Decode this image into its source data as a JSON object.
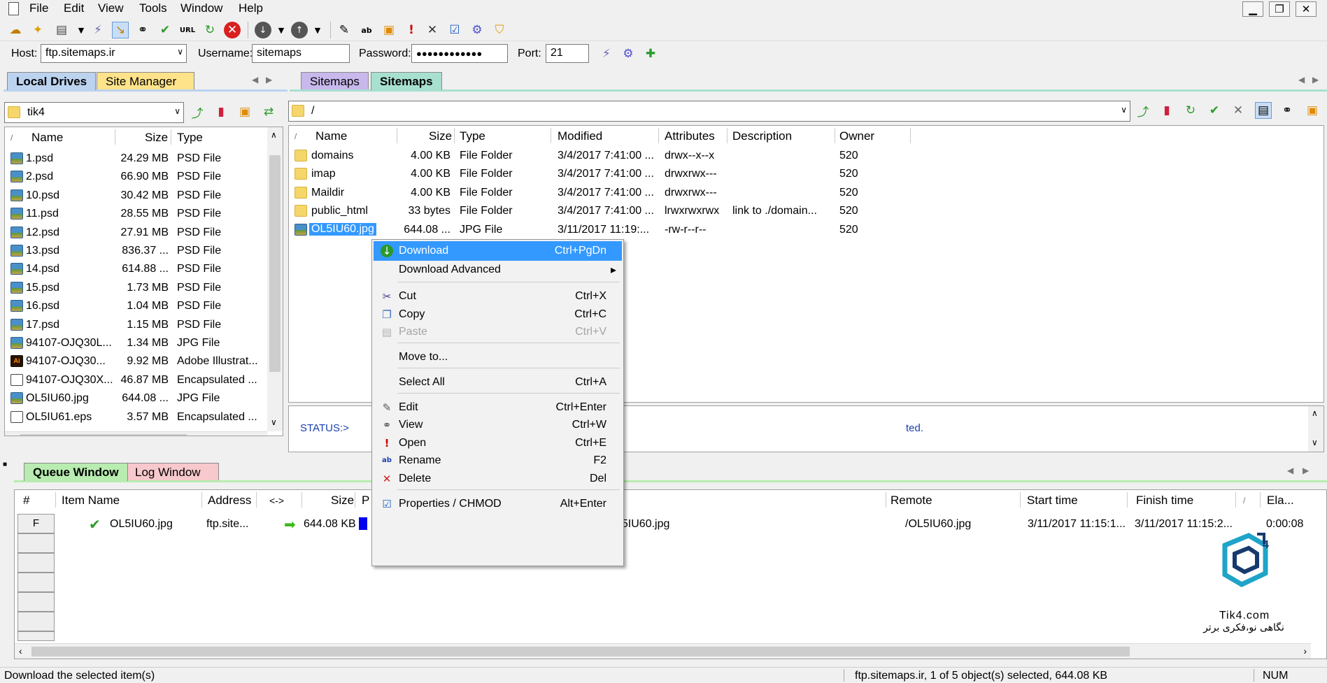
{
  "menu": [
    "File",
    "Edit",
    "View",
    "Tools",
    "Window",
    "Help"
  ],
  "connection": {
    "host_label": "Host:",
    "host_value": "ftp.sitemaps.ir",
    "username_label": "Username:",
    "username_value": "sitemaps",
    "password_label": "Password:",
    "password_value": "●●●●●●●●●●●●",
    "port_label": "Port:",
    "port_value": "21"
  },
  "left_tabs": [
    "Local Drives",
    "Site Manager"
  ],
  "right_tabs": [
    "Sitemaps",
    "Sitemaps"
  ],
  "left_path": "tik4",
  "right_path": "/",
  "local": {
    "columns": [
      "/",
      "Name",
      "Size",
      "Type"
    ],
    "rows": [
      {
        "name": "1.psd",
        "size": "24.29 MB",
        "type": "PSD File",
        "icon": "image-file-icon"
      },
      {
        "name": "2.psd",
        "size": "66.90 MB",
        "type": "PSD File",
        "icon": "image-file-icon"
      },
      {
        "name": "10.psd",
        "size": "30.42 MB",
        "type": "PSD File",
        "icon": "image-file-icon"
      },
      {
        "name": "11.psd",
        "size": "28.55 MB",
        "type": "PSD File",
        "icon": "image-file-icon"
      },
      {
        "name": "12.psd",
        "size": "27.91 MB",
        "type": "PSD File",
        "icon": "image-file-icon"
      },
      {
        "name": "13.psd",
        "size": "836.37 ...",
        "type": "PSD File",
        "icon": "image-file-icon"
      },
      {
        "name": "14.psd",
        "size": "614.88 ...",
        "type": "PSD File",
        "icon": "image-file-icon"
      },
      {
        "name": "15.psd",
        "size": "1.73 MB",
        "type": "PSD File",
        "icon": "image-file-icon"
      },
      {
        "name": "16.psd",
        "size": "1.04 MB",
        "type": "PSD File",
        "icon": "image-file-icon"
      },
      {
        "name": "17.psd",
        "size": "1.15 MB",
        "type": "PSD File",
        "icon": "image-file-icon"
      },
      {
        "name": "94107-OJQ30L...",
        "size": "1.34 MB",
        "type": "JPG File",
        "icon": "image-file-icon"
      },
      {
        "name": "94107-OJQ30...",
        "size": "9.92 MB",
        "type": "Adobe Illustrat...",
        "icon": "illustrator-file-icon"
      },
      {
        "name": "94107-OJQ30X...",
        "size": "46.87 MB",
        "type": "Encapsulated ...",
        "icon": "eps-file-icon"
      },
      {
        "name": "OL5IU60.jpg",
        "size": "644.08 ...",
        "type": "JPG File",
        "icon": "image-file-icon"
      },
      {
        "name": "OL5IU61.eps",
        "size": "3.57 MB",
        "type": "Encapsulated ...",
        "icon": "eps-file-icon"
      }
    ]
  },
  "remote": {
    "columns": [
      "/",
      "Name",
      "Size",
      "Type",
      "Modified",
      "Attributes",
      "Description",
      "Owner"
    ],
    "rows": [
      {
        "name": "domains",
        "size": "4.00 KB",
        "type": "File Folder",
        "modified": "3/4/2017 7:41:00 ...",
        "attributes": "drwx--x--x",
        "description": "",
        "owner": "520",
        "icon": "folder-icon"
      },
      {
        "name": "imap",
        "size": "4.00 KB",
        "type": "File Folder",
        "modified": "3/4/2017 7:41:00 ...",
        "attributes": "drwxrwx---",
        "description": "",
        "owner": "520",
        "icon": "folder-icon"
      },
      {
        "name": "Maildir",
        "size": "4.00 KB",
        "type": "File Folder",
        "modified": "3/4/2017 7:41:00 ...",
        "attributes": "drwxrwx---",
        "description": "",
        "owner": "520",
        "icon": "folder-icon"
      },
      {
        "name": "public_html",
        "size": "33 bytes",
        "type": "File Folder",
        "modified": "3/4/2017 7:41:00 ...",
        "attributes": "lrwxrwxrwx",
        "description": "link to ./domain...",
        "owner": "520",
        "icon": "folder-icon"
      },
      {
        "name": "OL5IU60.jpg",
        "size": "644.08 ...",
        "type": "JPG File",
        "modified": "3/11/2017 11:19:...",
        "attributes": "-rw-r--r--",
        "description": "",
        "owner": "520",
        "icon": "image-file-icon"
      }
    ]
  },
  "status_log": {
    "prefix": "STATUS:>",
    "tail": "ted."
  },
  "bottom_tabs": [
    "Queue Window",
    "Log Window"
  ],
  "queue": {
    "columns": [
      "#",
      "Item Name",
      "Address",
      "<->",
      "Size",
      "P",
      "Remote",
      "Start time",
      "Finish time",
      "/",
      "Ela..."
    ],
    "row": {
      "num": "F",
      "name": "OL5IU60.jpg",
      "address": "ftp.site...",
      "size": "644.08 KB",
      "local_tail": "L5IU60.jpg",
      "remote": "/OL5IU60.jpg",
      "start": "3/11/2017 11:15:1...",
      "finish": "3/11/2017 11:15:2...",
      "elapsed": "0:00:08"
    }
  },
  "context_menu": [
    {
      "label": "Download",
      "shortcut": "Ctrl+PgDn",
      "icon": "download-icon",
      "highlighted": true
    },
    {
      "label": "Download Advanced",
      "shortcut": "",
      "icon": "",
      "submenu": true
    },
    {
      "label": "Cut",
      "shortcut": "Ctrl+X",
      "icon": "scissors-icon"
    },
    {
      "label": "Copy",
      "shortcut": "Ctrl+C",
      "icon": "copy-icon"
    },
    {
      "label": "Paste",
      "shortcut": "Ctrl+V",
      "icon": "paste-icon",
      "disabled": true
    },
    {
      "label": "Move to...",
      "shortcut": "",
      "icon": ""
    },
    {
      "label": "Select All",
      "shortcut": "Ctrl+A",
      "icon": ""
    },
    {
      "label": "Edit",
      "shortcut": "Ctrl+Enter",
      "icon": "edit-icon"
    },
    {
      "label": "View",
      "shortcut": "Ctrl+W",
      "icon": "view-icon"
    },
    {
      "label": "Open",
      "shortcut": "Ctrl+E",
      "icon": "exclamation-icon"
    },
    {
      "label": "Rename",
      "shortcut": "F2",
      "icon": "rename-icon"
    },
    {
      "label": "Delete",
      "shortcut": "Del",
      "icon": "delete-icon"
    },
    {
      "label": "Properties / CHMOD",
      "shortcut": "Alt+Enter",
      "icon": "properties-icon"
    }
  ],
  "watermark": {
    "brand": "Tik4.com",
    "tagline": "نگاهی نو،فکری برتر"
  },
  "statusbar": {
    "left": "Download the selected item(s)",
    "middle": "ftp.sitemaps.ir, 1 of 5 object(s) selected, 644.08 KB",
    "right": "NUM"
  },
  "colors": {
    "selection": "#3399ff",
    "tab_blue": "#bcd3f0",
    "tab_gold": "#ffe38a",
    "tab_purple": "#c8b8ec",
    "tab_teal": "#a8e0d0",
    "tab_green": "#b8ecb0",
    "tab_pink": "#f7c8cc",
    "status_text": "#1a3fb0"
  }
}
